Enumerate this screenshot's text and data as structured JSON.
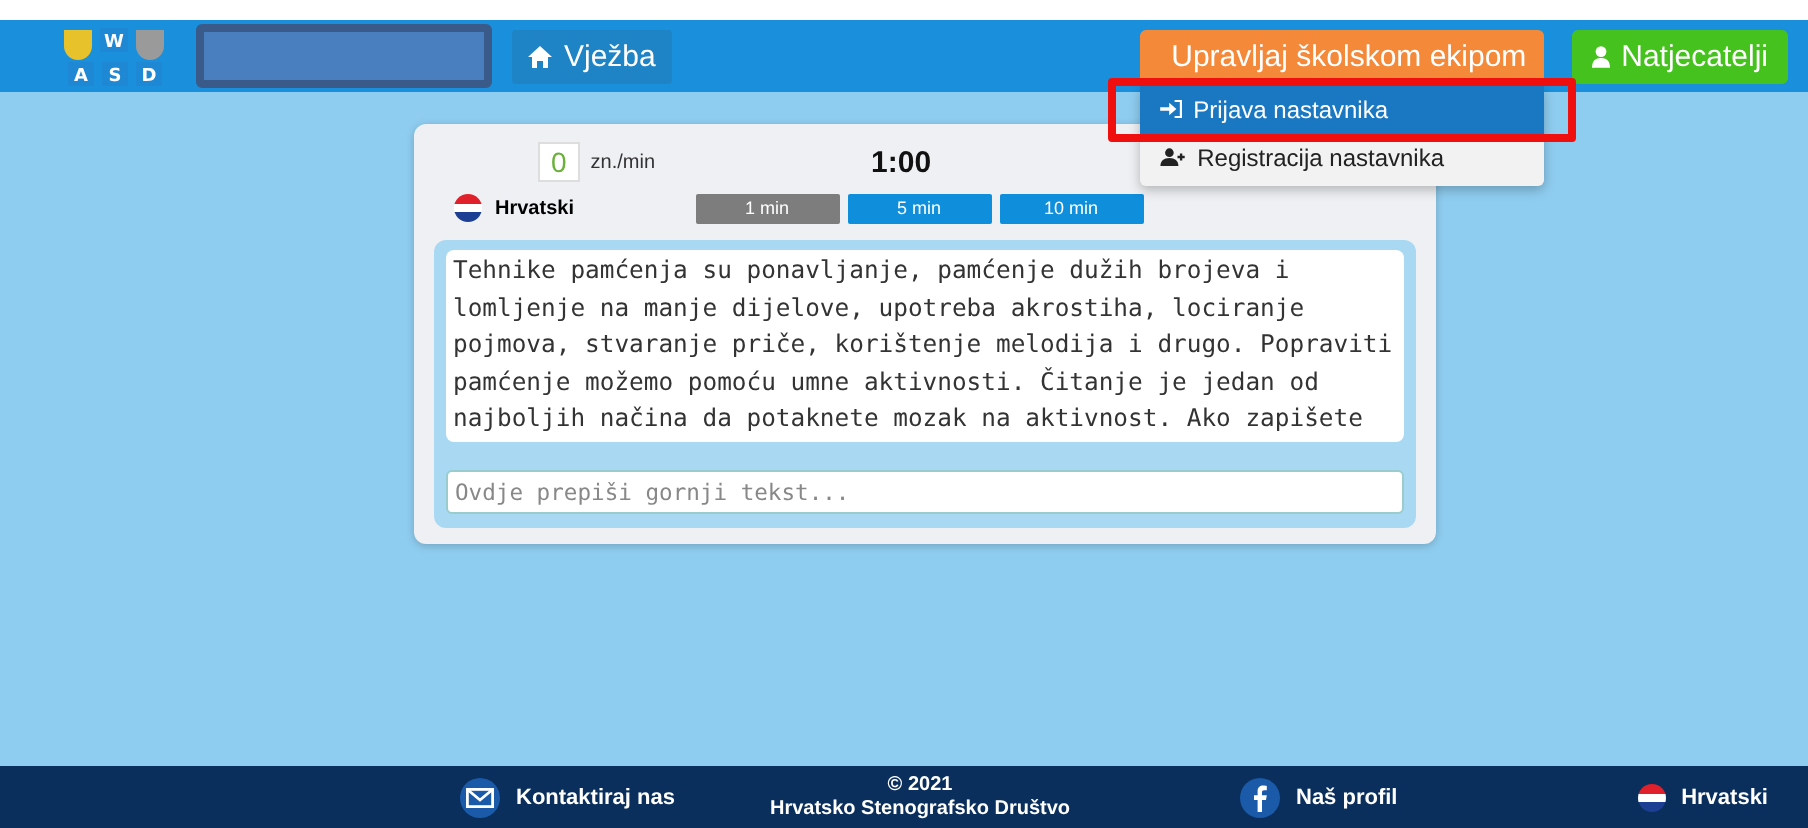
{
  "header": {
    "logo_letters": [
      "W",
      "A",
      "S",
      "D"
    ],
    "nav_items": [
      {
        "label": "Vježba",
        "kind": "home"
      }
    ],
    "team_button": {
      "label": "Upravljaj školskom ekipom",
      "expanded": true
    },
    "dropdown": [
      {
        "label": "Prijava nastavnika",
        "kind": "login",
        "selected": true,
        "highlighted": true
      },
      {
        "label": "Registracija nastavnika",
        "kind": "register",
        "selected": false,
        "highlighted": false
      }
    ],
    "competitors_button": {
      "label": "Natjecatelji"
    }
  },
  "practice": {
    "speed": "0",
    "speed_unit": "zn./min",
    "timer": "1:00",
    "language": "Hrvatski",
    "durations": [
      {
        "label": "1 min",
        "selected": true
      },
      {
        "label": "5 min",
        "selected": false
      },
      {
        "label": "10 min",
        "selected": false
      }
    ],
    "source_text": "Tehnike pamćenja su ponavljanje, pamćenje dužih brojeva i lomljenje na manje dijelove, upotreba akrostiha, lociranje pojmova, stvaranje priče, korištenje melodija i drugo. Popraviti pamćenje možemo pomoću umne aktivnosti. Čitanje je jedan od najboljih načina da potaknete mozak na aktivnost. Ako zapišete",
    "input": {
      "placeholder": "Ovdje prepiši gornji tekst..."
    }
  },
  "footer": {
    "contact": "Kontaktiraj nas",
    "copyright": "© 2021",
    "organization": "Hrvatsko Stenografsko Društvo",
    "profile": "Naš profil",
    "language": "Hrvatski"
  }
}
